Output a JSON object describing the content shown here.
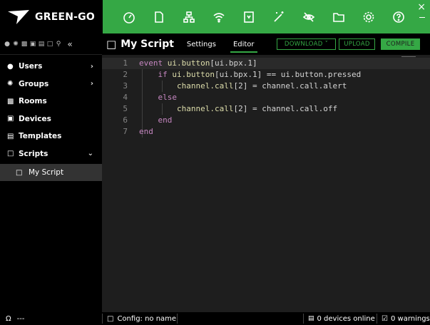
{
  "app": {
    "logo_text": "GREEN-GO"
  },
  "toolbar": {
    "icons": [
      "dashboard-icon",
      "document-icon",
      "network-icon",
      "wireless-icon",
      "device-icon",
      "magic-wand-icon",
      "visibility-off-icon",
      "folder-icon",
      "gear-icon",
      "help-icon"
    ]
  },
  "window": {
    "close_label": "×"
  },
  "sidebar": {
    "icons": [
      "users-icon",
      "groups-icon",
      "rooms-icon",
      "devices-icon",
      "templates-icon",
      "scripts-icon",
      "search-icon"
    ],
    "collapse_label": "«",
    "items": [
      {
        "label": "Users",
        "icon": "user-icon",
        "chevron": "›"
      },
      {
        "label": "Groups",
        "icon": "groups-icon",
        "chevron": "›"
      },
      {
        "label": "Rooms",
        "icon": "rooms-icon"
      },
      {
        "label": "Devices",
        "icon": "devices-icon"
      },
      {
        "label": "Templates",
        "icon": "templates-icon"
      },
      {
        "label": "Scripts",
        "icon": "scripts-icon",
        "chevron": "⌄"
      }
    ],
    "sub_item": {
      "label": "My Script",
      "icon": "script-icon"
    }
  },
  "main": {
    "title": "My Script",
    "tabs": [
      {
        "label": "Settings"
      },
      {
        "label": "Editor",
        "active": true
      }
    ],
    "buttons": {
      "download": "DOWNLOAD ˅",
      "upload": "UPLOAD",
      "compile": "COMPILE"
    }
  },
  "editor": {
    "lines": [
      {
        "n": "1",
        "parts": [
          [
            "kw",
            "event "
          ],
          [
            "fn",
            "ui.button"
          ],
          [
            "tx",
            "[ui.bpx.1]"
          ]
        ]
      },
      {
        "n": "2",
        "parts": [
          [
            "tx",
            "    "
          ],
          [
            "kw",
            "if "
          ],
          [
            "fn",
            "ui.button"
          ],
          [
            "tx",
            "[ui.bpx.1] == ui.button.pressed"
          ]
        ]
      },
      {
        "n": "3",
        "parts": [
          [
            "tx",
            "        "
          ],
          [
            "fn",
            "channel.call"
          ],
          [
            "tx",
            "[2] = channel.call.alert"
          ]
        ]
      },
      {
        "n": "4",
        "parts": [
          [
            "tx",
            "    "
          ],
          [
            "kw",
            "else"
          ]
        ]
      },
      {
        "n": "5",
        "parts": [
          [
            "tx",
            "        "
          ],
          [
            "fn",
            "channel.call"
          ],
          [
            "tx",
            "[2] = channel.call.off"
          ]
        ]
      },
      {
        "n": "6",
        "parts": [
          [
            "tx",
            "    "
          ],
          [
            "kw",
            "end"
          ]
        ]
      },
      {
        "n": "7",
        "parts": [
          [
            "kw",
            "end"
          ]
        ]
      }
    ]
  },
  "status": {
    "user": "---",
    "config": "Config: no name",
    "devices_online": "0 devices online",
    "warnings": "0 warnings"
  },
  "colors": {
    "accent": "#35a845",
    "keyword": "#c586c0",
    "function": "#dcdcaa",
    "text": "#d4d4d4"
  }
}
